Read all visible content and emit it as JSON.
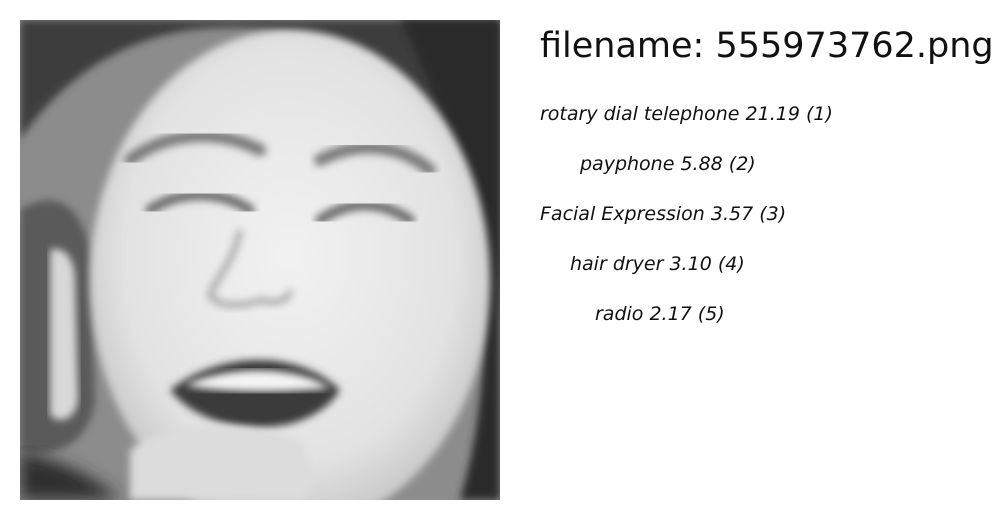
{
  "filename_line": "filename: 555973762.png",
  "predictions": [
    "rotary dial telephone 21.19 (1)",
    "payphone  5.88 (2)",
    "Facial Expression  3.57 (3)",
    "hair dryer  3.10 (4)",
    "radio  2.17 (5)"
  ]
}
